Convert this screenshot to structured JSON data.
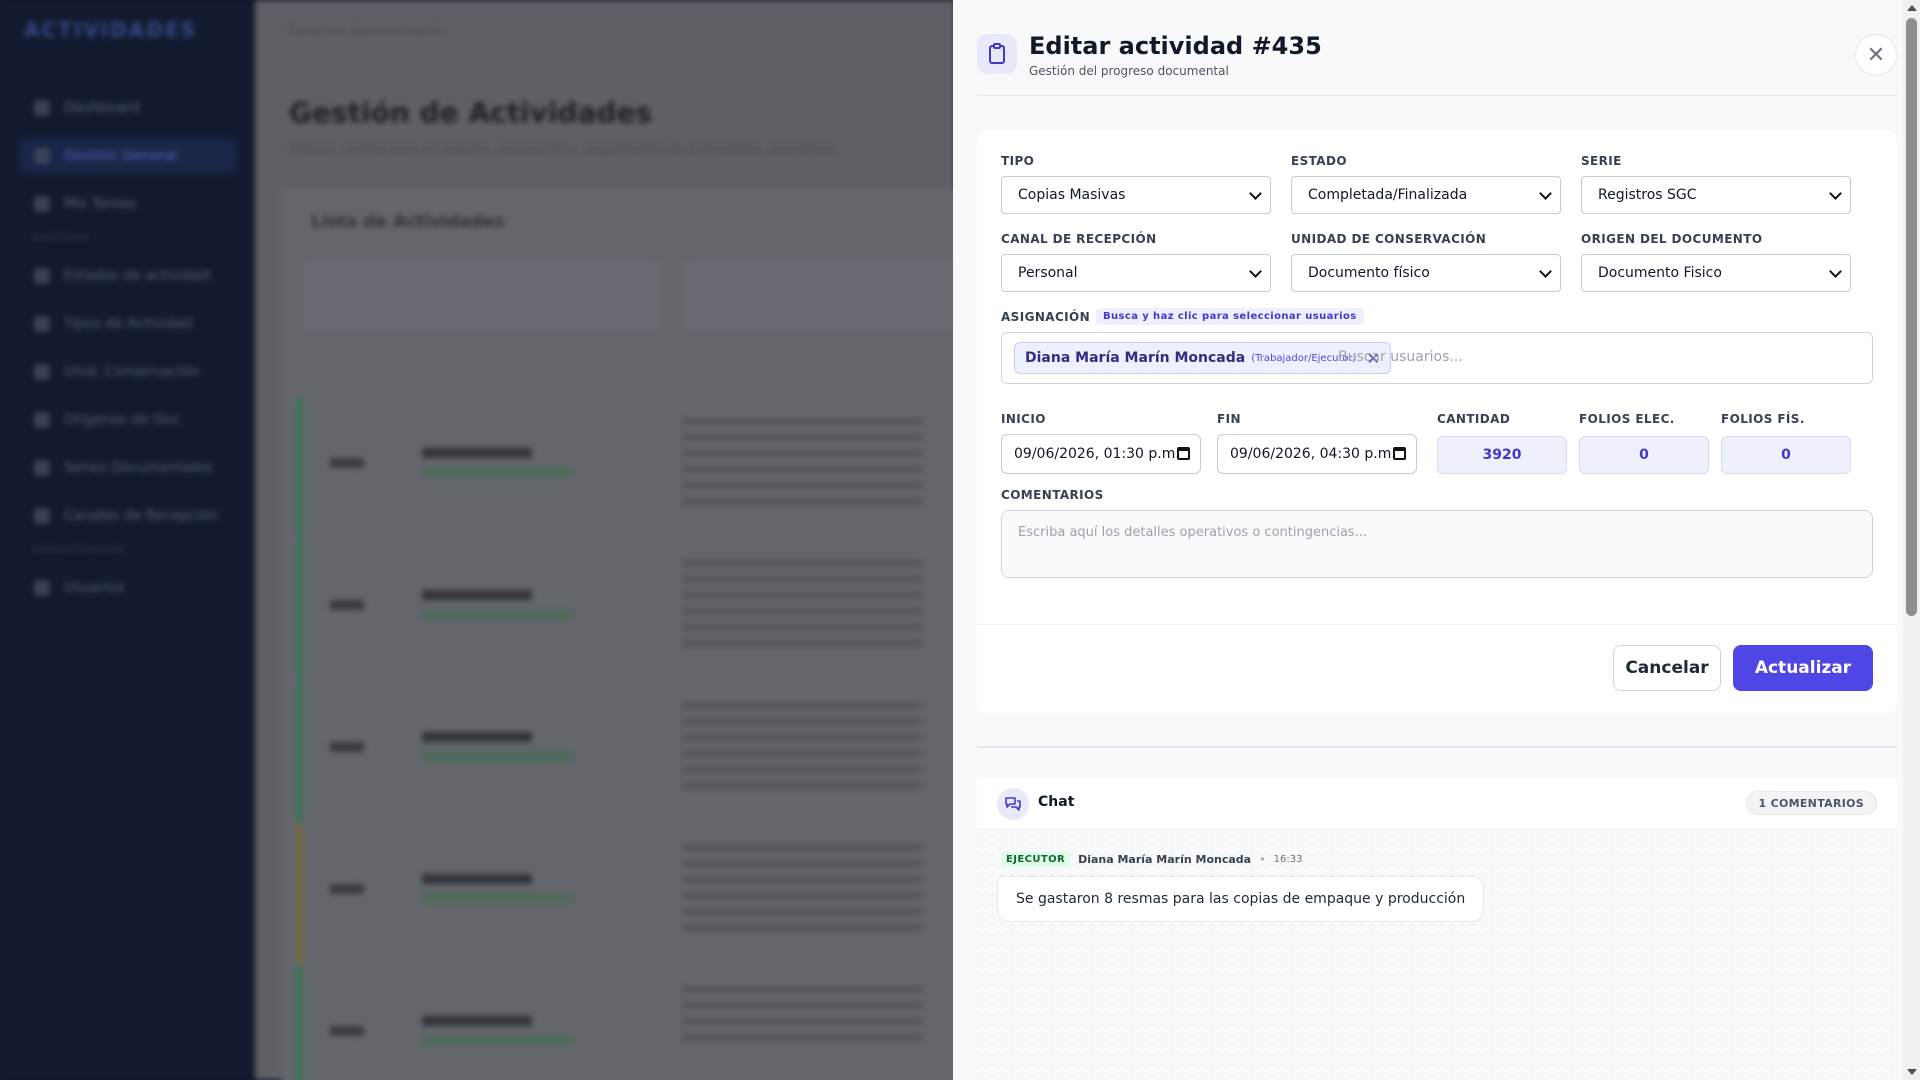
{
  "background": {
    "brand": "ACTIVIDADES",
    "nav": [
      {
        "label": "Dashboard"
      },
      {
        "label": "Gestión General"
      },
      {
        "label": "Mis Tareas"
      },
      {
        "label": "Estados de actividad"
      },
      {
        "label": "Tipos de Actividad"
      },
      {
        "label": "Unid. Conservación"
      },
      {
        "label": "Orígenes de Doc"
      },
      {
        "label": "Series Documentales"
      },
      {
        "label": "Canales de Recepción"
      },
      {
        "label": "Usuarios"
      }
    ],
    "nav_sections": [
      "MAESTROS",
      "ADMINISTRACIÓN"
    ],
    "breadcrumb": "Panel de Administración",
    "page_title": "Gestión de Actividades",
    "page_subtitle": "Módulo central para el registro, asignación y seguimiento de actividades operativas.",
    "list_title": "Lista de Actividades"
  },
  "modal": {
    "title": "Editar actividad #435",
    "subtitle": "Gestión del progreso documental",
    "fields": {
      "tipo": {
        "label": "TIPO",
        "value": "Copias Masivas"
      },
      "estado": {
        "label": "ESTADO",
        "value": "Completada/Finalizada"
      },
      "serie": {
        "label": "SERIE",
        "value": "Registros SGC"
      },
      "canal": {
        "label": "CANAL DE RECEPCIÓN",
        "value": "Personal"
      },
      "unidad": {
        "label": "UNIDAD DE CONSERVACIÓN",
        "value": "Documento físico"
      },
      "origen": {
        "label": "ORIGEN DEL DOCUMENTO",
        "value": "Documento Fisico"
      }
    },
    "assignment": {
      "label": "ASIGNACIÓN",
      "hint": "Busca y haz clic para seleccionar usuarios",
      "chip_name": "Diana María Marín Moncada",
      "chip_role": "(Trabajador/Ejecutor)",
      "search_placeholder": "Buscar usuarios..."
    },
    "inicio": {
      "label": "INICIO",
      "value": "09/06/2026, 01:30 p.m."
    },
    "fin": {
      "label": "FIN",
      "value": "09/06/2026, 04:30 p.m."
    },
    "cantidad": {
      "label": "CANTIDAD",
      "value": "3920"
    },
    "folios_elec": {
      "label": "FOLIOS ELEC.",
      "value": "0"
    },
    "folios_fis": {
      "label": "FOLIOS FÍS.",
      "value": "0"
    },
    "comentarios": {
      "label": "COMENTARIOS",
      "placeholder": "Escriba aquí los detalles operativos o contingencias..."
    },
    "buttons": {
      "cancel": "Cancelar",
      "update": "Actualizar"
    }
  },
  "chat": {
    "title": "Chat",
    "count_badge": "1 COMENTARIOS",
    "messages": [
      {
        "role": "EJECUTOR",
        "author": "Diana María Marín Moncada",
        "separator": "•",
        "time": "16:33",
        "text": "Se gastaron 8 resmas para las copias de empaque y producción"
      }
    ]
  },
  "colors": {
    "accent": "#4f46e5",
    "sidebar": "#111a2e",
    "success": "#166534"
  },
  "icons": [
    "clipboard-icon",
    "close-icon",
    "chat-bubbles-icon",
    "calendar-icon",
    "chevron-down-icon"
  ]
}
